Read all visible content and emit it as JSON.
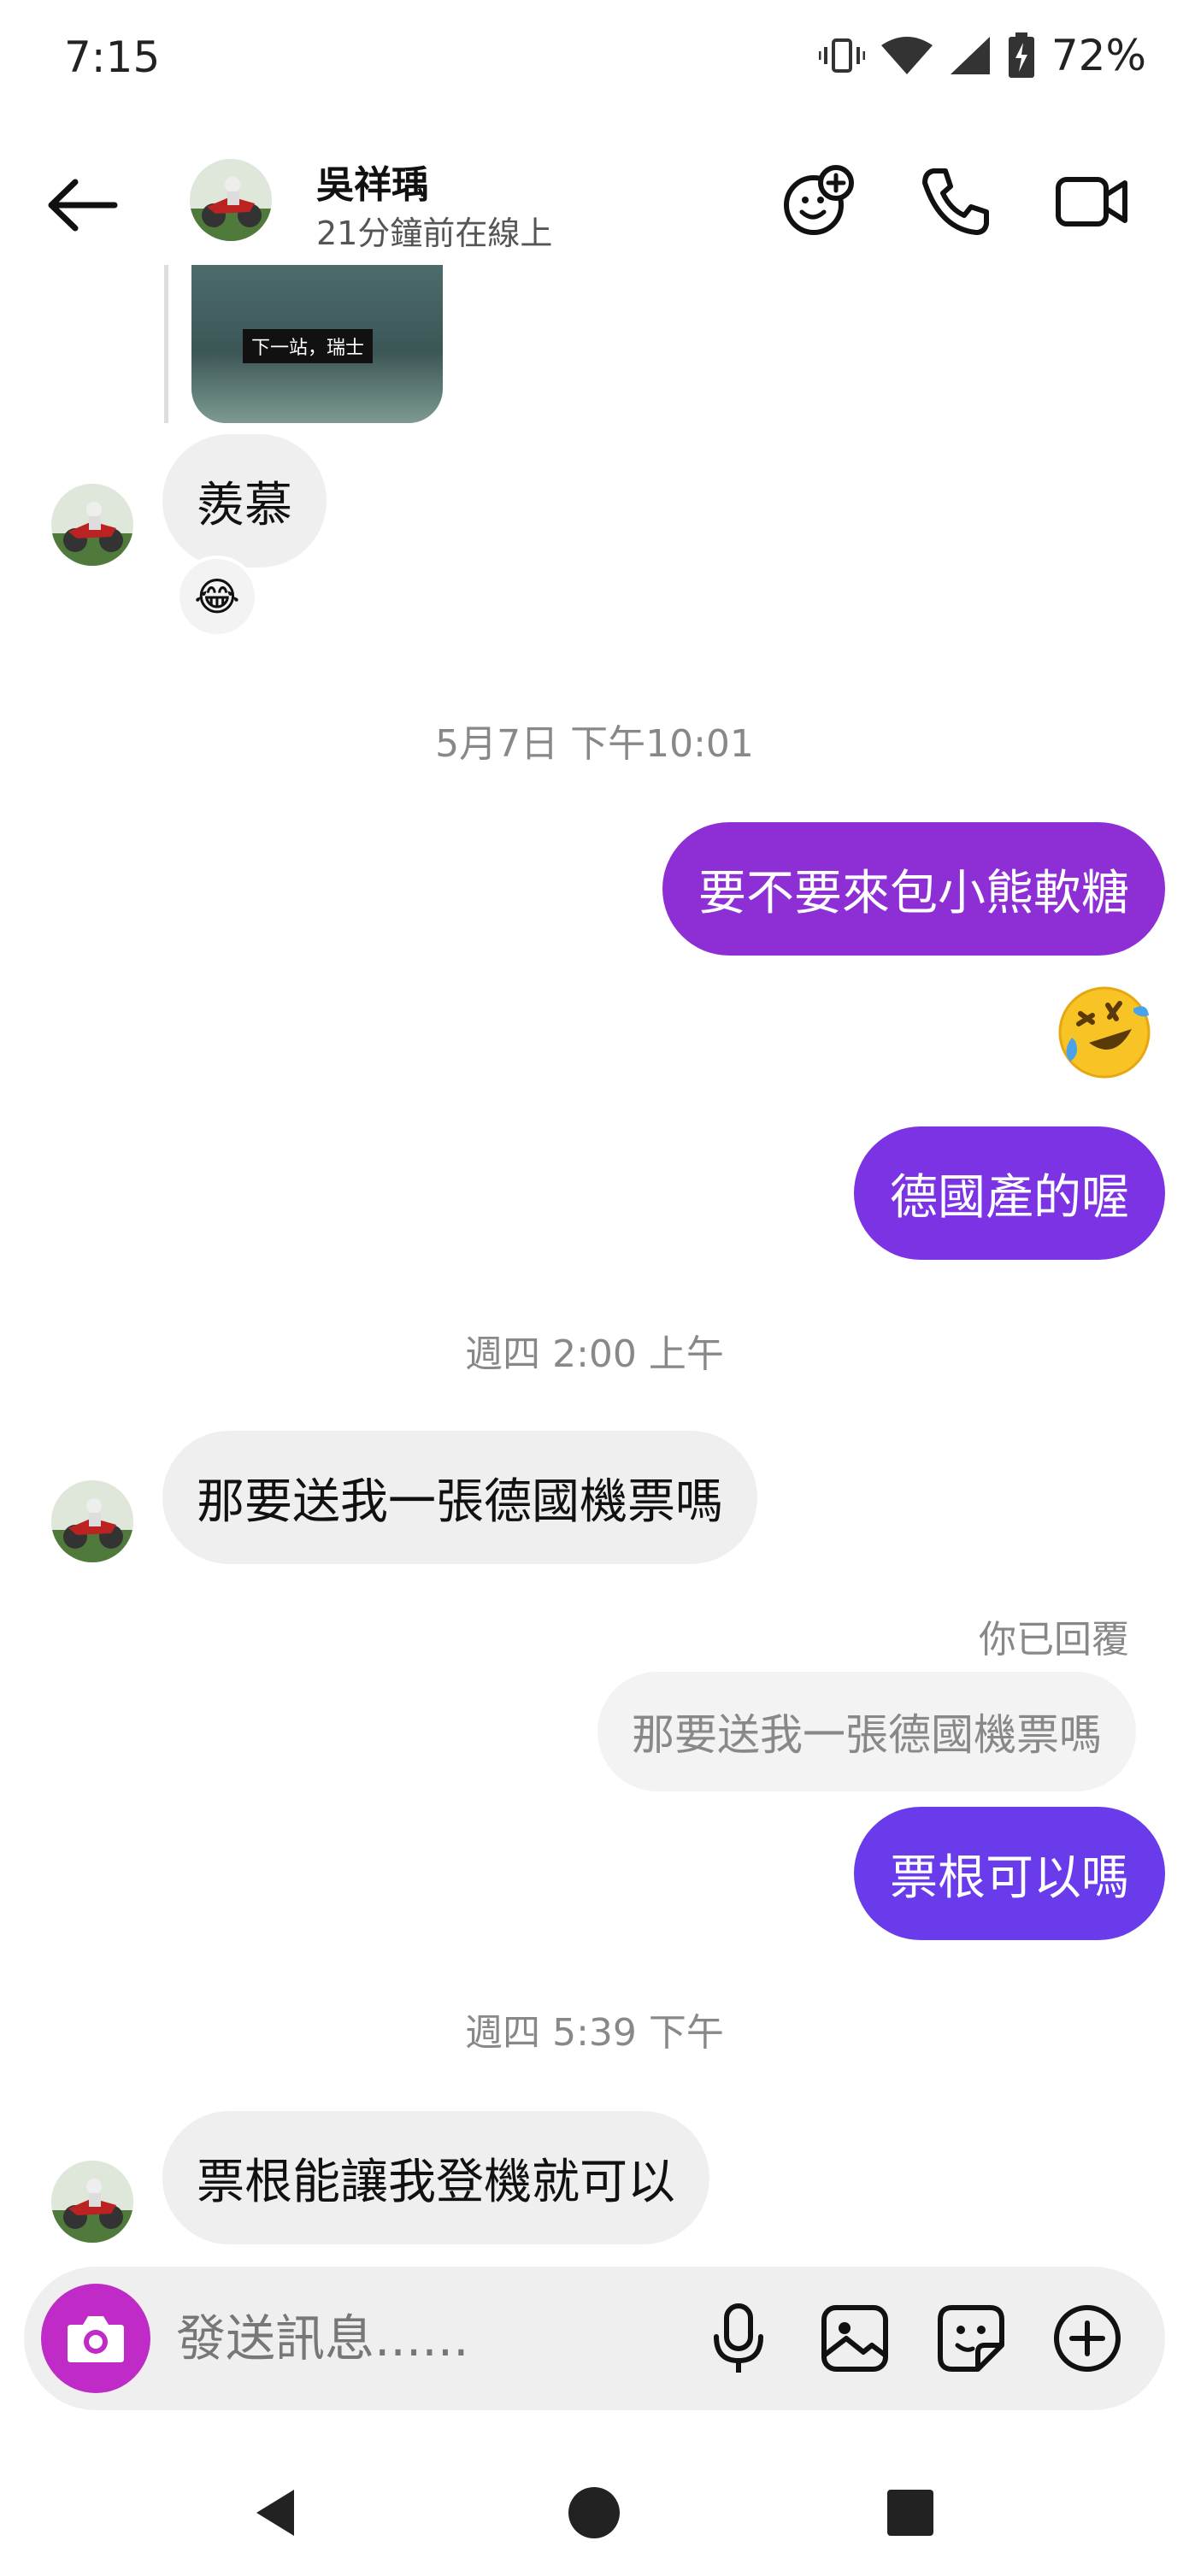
{
  "status_bar": {
    "time": "7:15",
    "battery": "72%"
  },
  "header": {
    "contact_name": "吳祥瑀",
    "contact_status": "21分鐘前在線上"
  },
  "chat": {
    "shared_media_caption": "下一站，瑞士",
    "messages": [
      {
        "id": "m1",
        "direction": "in",
        "text": "羨慕",
        "reaction": "😂"
      },
      {
        "id": "t1",
        "type": "timestamp",
        "text": "5月7日 下午10:01"
      },
      {
        "id": "m2",
        "direction": "out",
        "text": "要不要來包小熊軟糖"
      },
      {
        "id": "m3",
        "direction": "out",
        "type": "emoji",
        "text": "🤣"
      },
      {
        "id": "m4",
        "direction": "out",
        "text": "德國產的喔"
      },
      {
        "id": "t2",
        "type": "timestamp",
        "text": "週四 2:00 上午"
      },
      {
        "id": "m5",
        "direction": "in",
        "text": "那要送我一張德國機票嗎"
      },
      {
        "id": "m6",
        "direction": "out",
        "reply_label": "你已回覆",
        "quoted": "那要送我一張德國機票嗎",
        "text": "票根可以嗎"
      },
      {
        "id": "t3",
        "type": "timestamp",
        "text": "週四 5:39 下午"
      },
      {
        "id": "m7",
        "direction": "in",
        "text": "票根能讓我登機就可以"
      }
    ]
  },
  "composer": {
    "placeholder": "發送訊息......"
  },
  "colors": {
    "bubble_out_1": "#8e2fd6",
    "bubble_out_2": "#7b33e3",
    "bubble_out_3": "#6a3bea",
    "bubble_in": "#efefef",
    "camera": "#c02bc7"
  },
  "icons": {
    "back": "back-arrow-icon",
    "games": "smiley-plus-icon",
    "call": "phone-icon",
    "video": "video-camera-icon",
    "camera": "camera-icon",
    "mic": "microphone-icon",
    "gallery": "image-icon",
    "sticker": "sticker-icon",
    "more": "plus-circle-icon"
  }
}
